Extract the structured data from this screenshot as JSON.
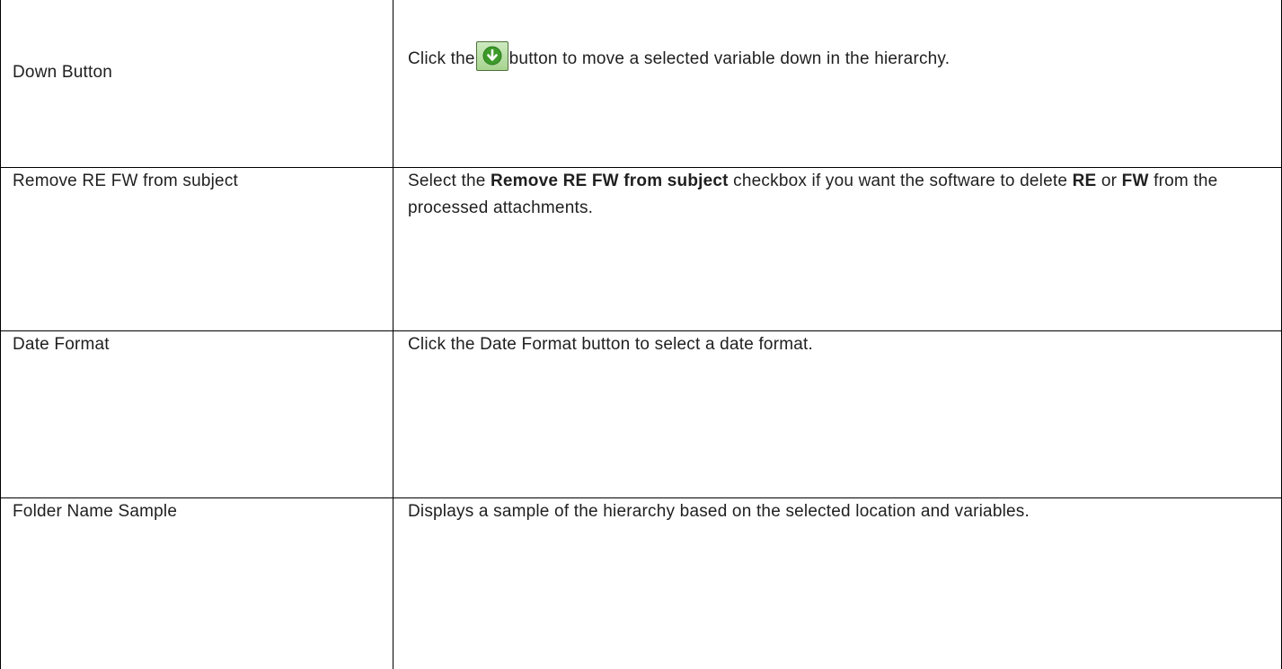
{
  "rows": [
    {
      "term": "Down Button",
      "desc_before": "Click the",
      "icon": "green-down-arrow-icon",
      "desc_after": "button to move a selected variable down in the hierarchy."
    },
    {
      "term": "Remove RE FW from subject",
      "desc_1": "Select the ",
      "desc_bold_1": "Remove RE FW from subject",
      "desc_2": " checkbox if you want the software to delete ",
      "desc_bold_2": "RE",
      "desc_3": " or ",
      "desc_bold_3": "FW",
      "desc_4": " from the processed attachments."
    },
    {
      "term": "Date Format",
      "desc": "Click the Date Format button to select a date format."
    },
    {
      "term": "Folder Name Sample",
      "desc": "Displays a sample of the hierarchy based on the selected location and variables."
    }
  ],
  "colors": {
    "icon_fill": "#3c9a2a",
    "icon_frame": "#a7d490",
    "border": "#000000",
    "text": "#1f1f1f"
  }
}
